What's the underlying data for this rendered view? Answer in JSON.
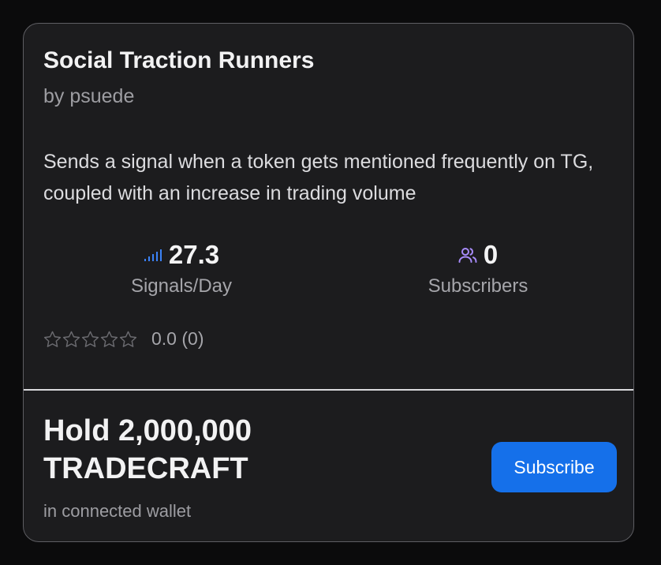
{
  "card": {
    "title": "Social Traction Runners",
    "author": "by psuede",
    "description": "Sends a signal when a token gets mentioned frequently on TG, coupled with an increase in trading volume"
  },
  "stats": {
    "signals": {
      "icon": "signal-bars-icon",
      "value": "27.3",
      "label": "Signals/Day"
    },
    "subscribers": {
      "icon": "users-icon",
      "value": "0",
      "label": "Subscribers"
    }
  },
  "rating": {
    "stars": 0,
    "max_stars": 5,
    "text": "0.0 (0)"
  },
  "requirement": {
    "text": "Hold 2,000,000 TRADECRAFT",
    "note": "in connected wallet"
  },
  "subscribe_button": {
    "label": "Subscribe"
  },
  "colors": {
    "background": "#0b0b0c",
    "card": "#1c1c1e",
    "accent_blue": "#1570ea",
    "signal_icon": "#3b82f6",
    "users_icon": "#a78bfa",
    "star_outline": "#6b6b70"
  }
}
